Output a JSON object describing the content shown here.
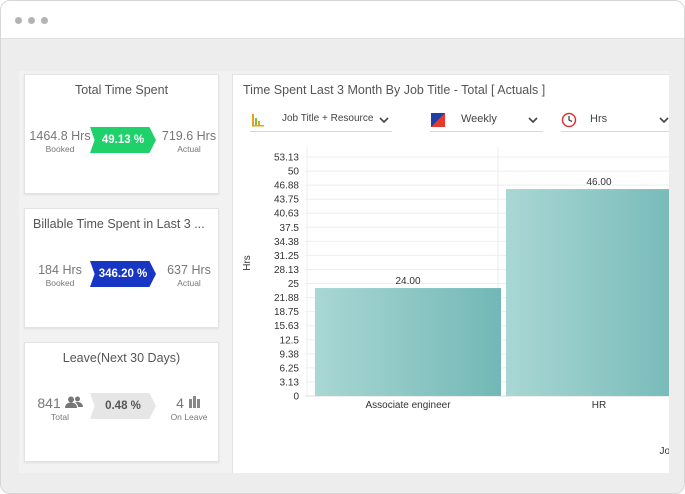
{
  "cards": {
    "total_time": {
      "title": "Total Time Spent",
      "booked_value": "1464.8 Hrs",
      "booked_label": "Booked",
      "percent": "49.13 %",
      "actual_value": "719.6 Hrs",
      "actual_label": "Actual",
      "badge_color": "#1fd16a"
    },
    "billable_time": {
      "title": "Billable Time Spent in Last 3 ...",
      "booked_value": "184 Hrs",
      "booked_label": "Booked",
      "percent": "346.20 %",
      "actual_value": "637 Hrs",
      "actual_label": "Actual",
      "badge_color": "#1736c4"
    },
    "leave": {
      "title": "Leave(Next 30 Days)",
      "total_value": "841",
      "total_label": "Total",
      "percent": "0.48 %",
      "on_leave_value": "4",
      "on_leave_label": "On Leave",
      "badge_color": "#e6e6e6"
    }
  },
  "chart_panel": {
    "title": "Time Spent Last 3 Month By Job Title - Total [ Actuals ]",
    "filters": {
      "group_by": "Job Title + Resource",
      "period": "Weekly",
      "unit": "Hrs"
    },
    "icons": {
      "group_by": "bar-chart-icon",
      "period": "calendar-icon",
      "unit": "clock-icon"
    }
  },
  "chart_data": {
    "type": "bar",
    "title": "",
    "xlabel": "Jo",
    "ylabel": "Hrs",
    "categories": [
      "Associate engineer",
      "HR"
    ],
    "values": [
      24.0,
      46.0
    ],
    "data_labels": [
      "24.00",
      "46.00"
    ],
    "ylim": [
      0,
      53.13
    ],
    "yticks": [
      "0",
      "3.13",
      "6.25",
      "9.38",
      "12.5",
      "15.63",
      "18.75",
      "21.88",
      "25",
      "28.13",
      "31.25",
      "34.38",
      "37.5",
      "40.63",
      "43.75",
      "46.88",
      "50",
      "53.13"
    ],
    "grid": true,
    "bar_color": "#77bcbb"
  }
}
